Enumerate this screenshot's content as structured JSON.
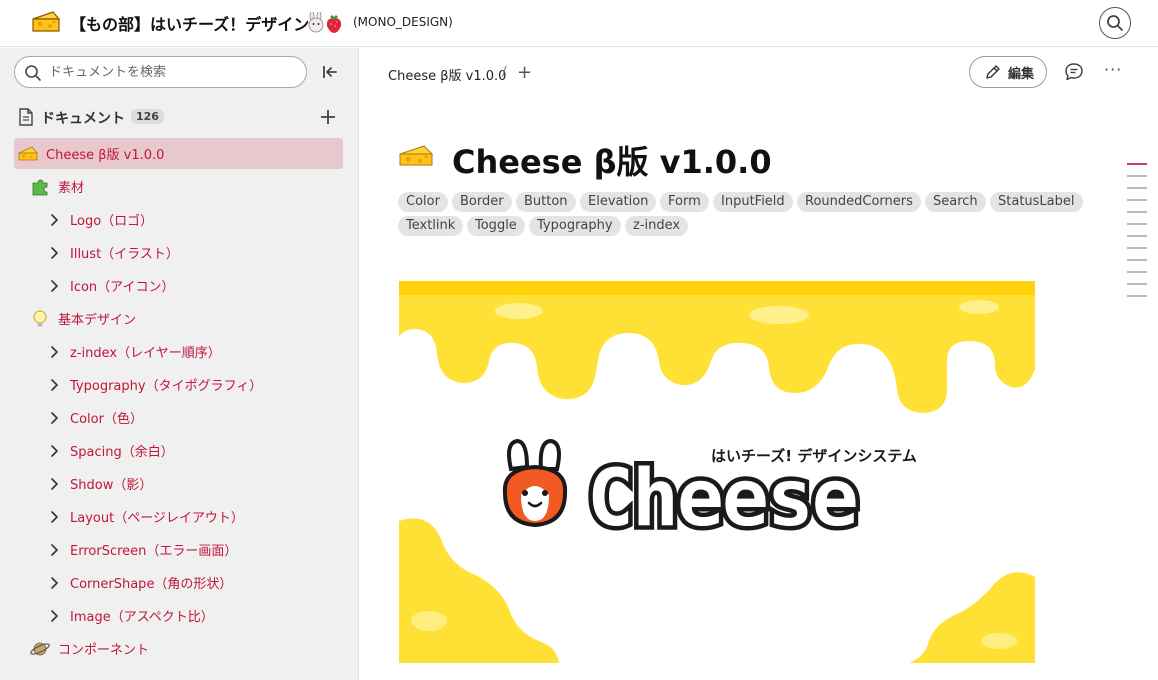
{
  "header": {
    "title": "【もの部】はいチーズ！デザイン",
    "workspace": "(MONO_DESIGN)"
  },
  "sidebar": {
    "search_placeholder": "ドキュメントを検索",
    "doc_label": "ドキュメント",
    "doc_count": "126",
    "items": [
      {
        "label": "Cheese β版 v1.0.0",
        "level": 0,
        "kind": "cheese",
        "active": true
      },
      {
        "label": "素材",
        "level": 0,
        "kind": "puzzle"
      },
      {
        "label": "Logo（ロゴ）",
        "level": 1,
        "kind": "chevron"
      },
      {
        "label": "Illust（イラスト）",
        "level": 1,
        "kind": "chevron"
      },
      {
        "label": "Icon（アイコン）",
        "level": 1,
        "kind": "chevron"
      },
      {
        "label": "基本デザイン",
        "level": 0,
        "kind": "bulb"
      },
      {
        "label": "z-index（レイヤー順序）",
        "level": 1,
        "kind": "chevron"
      },
      {
        "label": "Typography（タイポグラフィ）",
        "level": 1,
        "kind": "chevron"
      },
      {
        "label": "Color（色）",
        "level": 1,
        "kind": "chevron"
      },
      {
        "label": "Spacing（余白）",
        "level": 1,
        "kind": "chevron"
      },
      {
        "label": "Shdow（影）",
        "level": 1,
        "kind": "chevron"
      },
      {
        "label": "Layout（ページレイアウト）",
        "level": 1,
        "kind": "chevron"
      },
      {
        "label": "ErrorScreen（エラー画面）",
        "level": 1,
        "kind": "chevron"
      },
      {
        "label": "CornerShape（角の形状）",
        "level": 1,
        "kind": "chevron"
      },
      {
        "label": "Image（アスペクト比）",
        "level": 1,
        "kind": "chevron"
      },
      {
        "label": "コンポーネント",
        "level": 0,
        "kind": "planet"
      }
    ]
  },
  "main": {
    "breadcrumb": "Cheese β版 v1.0.0",
    "breadcrumb_sep": "/",
    "add_label": "+",
    "edit_label": "編集",
    "more_label": "···",
    "title": "Cheese β版 v1.0.0",
    "tags": [
      "Color",
      "Border",
      "Button",
      "Elevation",
      "Form",
      "InputField",
      "RoundedCorners",
      "Search",
      "StatusLabel",
      "Textlink",
      "Toggle",
      "Typography",
      "z-index"
    ],
    "hero": {
      "tagline": "はいチーズ! デザインシステム",
      "wordmark": "Cheese"
    }
  },
  "colors": {
    "accent": "#c0163a",
    "active_bg": "#e8c8cd",
    "cheese_yellow": "#ffe135",
    "cheese_pale": "#fff6b0",
    "mascot_orange": "#f15a22"
  }
}
